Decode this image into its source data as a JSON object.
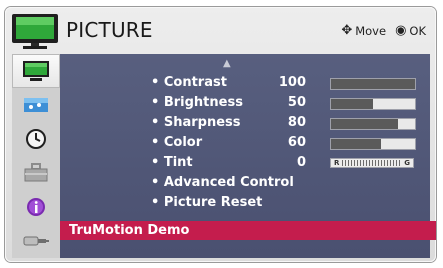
{
  "header": {
    "title": "PICTURE",
    "move_glyph": "✥",
    "move_label": "Move",
    "ok_glyph": "◉",
    "ok_label": "OK"
  },
  "scroll_up_glyph": "▲",
  "sidebar": {
    "items": [
      {
        "name": "picture-tv-icon",
        "selected": true
      },
      {
        "name": "screen-settings-icon",
        "selected": false
      },
      {
        "name": "clock-icon",
        "selected": false
      },
      {
        "name": "lock-icon",
        "selected": false
      },
      {
        "name": "info-option-icon",
        "selected": false
      },
      {
        "name": "input-connector-icon",
        "selected": false
      }
    ]
  },
  "menu": {
    "bullet": "•",
    "items": [
      {
        "label": "Contrast",
        "value": "100",
        "level": 100
      },
      {
        "label": "Brightness",
        "value": "50",
        "level": 50
      },
      {
        "label": "Sharpness",
        "value": "80",
        "level": 80
      },
      {
        "label": "Color",
        "value": "60",
        "level": 60
      },
      {
        "label": "Tint",
        "value": "0",
        "tint_left": "R",
        "tint_right": "G"
      },
      {
        "label": "Advanced Control"
      },
      {
        "label": "Picture Reset"
      }
    ],
    "highlighted": "TruMotion Demo"
  },
  "colors": {
    "content_bg": "#585f7f",
    "highlight": "#c41d4d",
    "bar_fill": "#5a5a5a"
  }
}
